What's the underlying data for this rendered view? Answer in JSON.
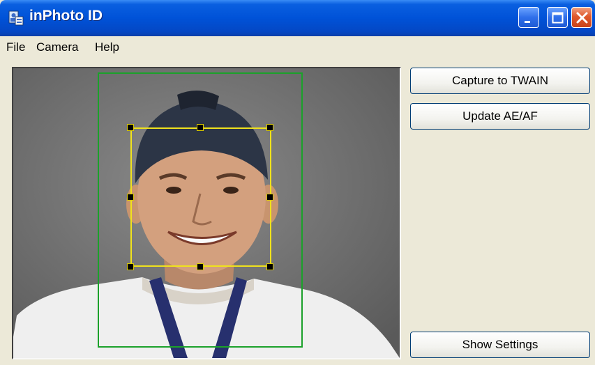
{
  "window": {
    "title": "inPhoto ID",
    "controls": [
      "minimize-icon",
      "maximize-icon",
      "close-icon"
    ]
  },
  "menu": {
    "items": [
      {
        "label": "File"
      },
      {
        "label": "Camera"
      },
      {
        "label": "Help"
      }
    ]
  },
  "preview": {
    "subject": "camera-preview-person-icon",
    "guide_color": "#1ba12a",
    "face_box_color": "#f0e21c"
  },
  "buttons": {
    "capture_label": "Capture to TWAIN",
    "update_label": "Update AE/AF",
    "settings_label": "Show Settings"
  },
  "colors": {
    "titlebar": "#0052d8",
    "window_bg": "#ece9d8",
    "close_button": "#e0592c"
  }
}
